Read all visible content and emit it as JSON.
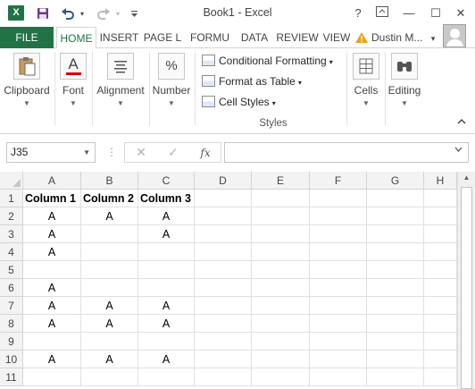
{
  "titlebar": {
    "app_icon": "excel-logo",
    "app_letter": "X",
    "save_icon": "save-icon",
    "undo_icon": "undo-icon",
    "redo_icon": "redo-icon",
    "customize_icon": "customize-qat-icon",
    "title": "Book1 - Excel",
    "help": "?",
    "ribbon_display_icon": "ribbon-display-icon",
    "minimize": "—",
    "maximize": "☐",
    "close": "✕"
  },
  "tabs": {
    "file": "FILE",
    "items": [
      "HOME",
      "INSERT",
      "PAGE L",
      "FORMU",
      "DATA",
      "REVIEW",
      "VIEW"
    ],
    "active": "HOME",
    "user_name": "Dustin M...",
    "user_caret": "▾"
  },
  "ribbon": {
    "groups": [
      {
        "label": "Clipboard",
        "icon": "clipboard-icon"
      },
      {
        "label": "Font",
        "icon": "font-color-icon",
        "glyph": "A"
      },
      {
        "label": "Alignment",
        "icon": "alignment-icon"
      },
      {
        "label": "Number",
        "icon": "percent-icon",
        "glyph": "%"
      },
      {
        "label": "Cells",
        "icon": "cells-icon"
      },
      {
        "label": "Editing",
        "icon": "binoculars-icon"
      }
    ],
    "styles": {
      "items": [
        "Conditional Formatting",
        "Format as Table",
        "Cell Styles"
      ],
      "label": "Styles"
    },
    "collapse": "^"
  },
  "formula_bar": {
    "name_box": "J35",
    "dots": "⋮",
    "cancel": "✕",
    "enter": "✓",
    "fx": "fx",
    "formula": ""
  },
  "grid": {
    "columns": [
      "A",
      "B",
      "C",
      "D",
      "E",
      "F",
      "G",
      "H"
    ],
    "rows": [
      "1",
      "2",
      "3",
      "4",
      "5",
      "6",
      "7",
      "8",
      "9",
      "10",
      "11"
    ],
    "cells": [
      [
        "Column 1",
        "Column 2",
        "Column 3",
        "",
        "",
        "",
        "",
        ""
      ],
      [
        "A",
        "A",
        "A",
        "",
        "",
        "",
        "",
        ""
      ],
      [
        "A",
        "",
        "A",
        "",
        "",
        "",
        "",
        ""
      ],
      [
        "A",
        "",
        "",
        "",
        "",
        "",
        "",
        ""
      ],
      [
        "",
        "",
        "",
        "",
        "",
        "",
        "",
        ""
      ],
      [
        "A",
        "",
        "",
        "",
        "",
        "",
        "",
        ""
      ],
      [
        "A",
        "A",
        "A",
        "",
        "",
        "",
        "",
        ""
      ],
      [
        "A",
        "A",
        "A",
        "",
        "",
        "",
        "",
        ""
      ],
      [
        "",
        "",
        "",
        "",
        "",
        "",
        "",
        ""
      ],
      [
        "A",
        "A",
        "A",
        "",
        "",
        "",
        "",
        ""
      ],
      [
        "",
        "",
        "",
        "",
        "",
        "",
        "",
        ""
      ]
    ]
  },
  "colors": {
    "brand_green": "#217346",
    "header_bg": "#f3f3f3",
    "gridline": "#e0e0e0"
  }
}
